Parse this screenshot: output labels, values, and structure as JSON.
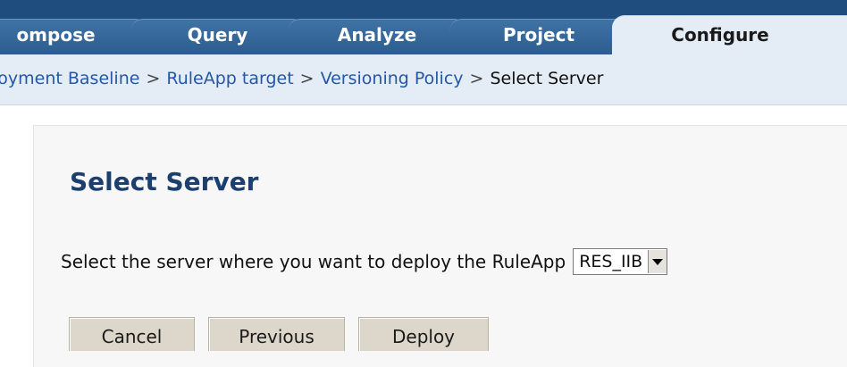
{
  "tabs": [
    {
      "label": "ompose"
    },
    {
      "label": "Query"
    },
    {
      "label": "Analyze"
    },
    {
      "label": "Project"
    },
    {
      "label": "Configure"
    }
  ],
  "breadcrumb": {
    "items": [
      "loyment Baseline",
      "RuleApp target",
      "Versioning Policy"
    ],
    "separator": ">",
    "current": "Select Server"
  },
  "main": {
    "title": "Select Server",
    "prompt": "Select the server where you want to deploy the RuleApp",
    "server_select": {
      "value": "RES_IIB"
    },
    "buttons": {
      "cancel": "Cancel",
      "previous": "Previous",
      "deploy": "Deploy"
    }
  },
  "colors": {
    "tabbar_bg": "#1f4d7d",
    "tab_bg": "#3f72a5",
    "active_tab_bg": "#e4edf6",
    "link": "#2457a6",
    "title": "#1c3f6e",
    "button_bg": "#dcd7ca"
  }
}
